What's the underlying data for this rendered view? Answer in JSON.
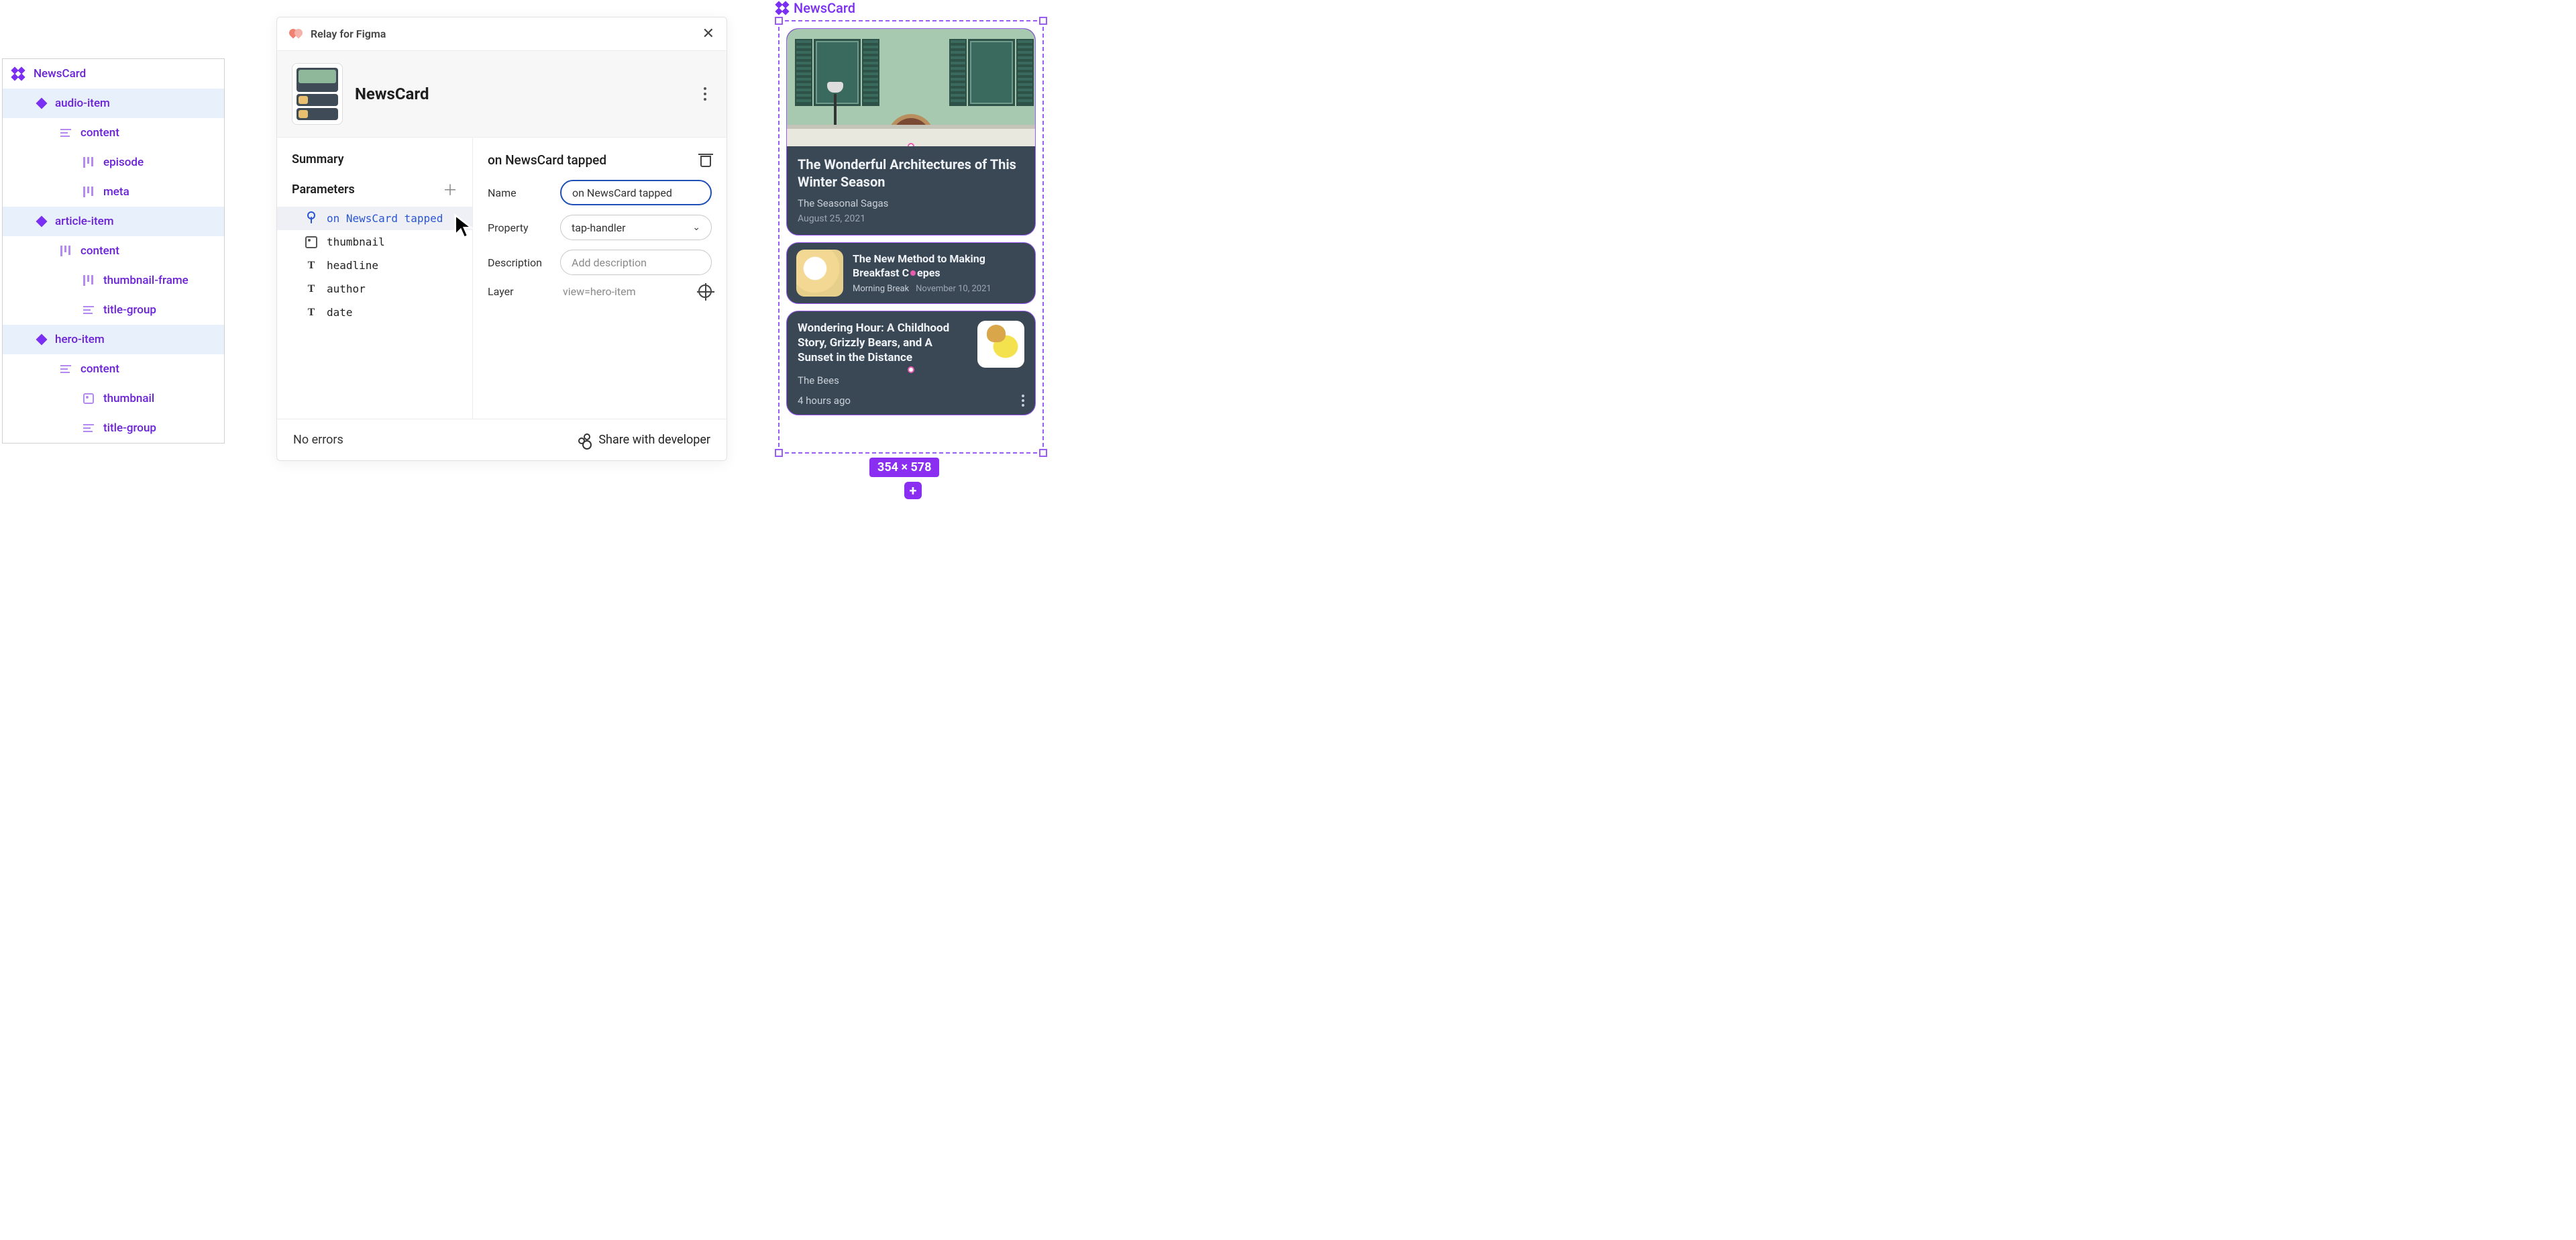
{
  "layers": {
    "root": "NewsCard",
    "items": [
      {
        "label": "audio-item",
        "icon": "diamond1",
        "indent": 1,
        "selected": true
      },
      {
        "label": "content",
        "icon": "lines3",
        "indent": 2,
        "selected": false
      },
      {
        "label": "episode",
        "icon": "bars3",
        "indent": 3,
        "selected": false
      },
      {
        "label": "meta",
        "icon": "bars3",
        "indent": 3,
        "selected": false
      },
      {
        "label": "article-item",
        "icon": "diamond1",
        "indent": 1,
        "selected": true
      },
      {
        "label": "content",
        "icon": "bars3",
        "indent": 2,
        "selected": false
      },
      {
        "label": "thumbnail-frame",
        "icon": "bars3",
        "indent": 3,
        "selected": false
      },
      {
        "label": "title-group",
        "icon": "lines3",
        "indent": 3,
        "selected": false
      },
      {
        "label": "hero-item",
        "icon": "diamond1",
        "indent": 1,
        "selected": true
      },
      {
        "label": "content",
        "icon": "lines3",
        "indent": 2,
        "selected": false
      },
      {
        "label": "thumbnail",
        "icon": "imgicon",
        "indent": 3,
        "selected": false
      },
      {
        "label": "title-group",
        "icon": "lines3",
        "indent": 3,
        "selected": false
      }
    ]
  },
  "relay": {
    "brand": "Relay for Figma",
    "title": "NewsCard",
    "summary_label": "Summary",
    "parameters_label": "Parameters",
    "params": [
      {
        "label": "on NewsCard tapped",
        "icon": "tap",
        "selected": true
      },
      {
        "label": "thumbnail",
        "icon": "image",
        "selected": false
      },
      {
        "label": "headline",
        "icon": "text",
        "selected": false
      },
      {
        "label": "author",
        "icon": "text",
        "selected": false
      },
      {
        "label": "date",
        "icon": "text",
        "selected": false
      }
    ],
    "detail": {
      "heading": "on NewsCard tapped",
      "name_label": "Name",
      "name_value": "on NewsCard tapped",
      "property_label": "Property",
      "property_value": "tap-handler",
      "description_label": "Description",
      "description_placeholder": "Add description",
      "layer_label": "Layer",
      "layer_value": "view=hero-item"
    },
    "footer_status": "No errors",
    "footer_share": "Share with developer"
  },
  "canvas": {
    "label": "NewsCard",
    "size": "354 × 578",
    "hero": {
      "headline": "The Wonderful Architectures of This Winter Season",
      "author": "The Seasonal Sagas",
      "date": "August 25, 2021"
    },
    "article": {
      "headline_a": "The New Method to Making",
      "headline_b": "Breakfast C",
      "headline_c": "epes",
      "author": "Morning Break",
      "date": "November 10, 2021"
    },
    "audio": {
      "headline": "Wondering Hour: A Childhood Story, Grizzly Bears, and A Sunset in the Distance",
      "author": "The Bees",
      "date": "4 hours ago"
    }
  }
}
